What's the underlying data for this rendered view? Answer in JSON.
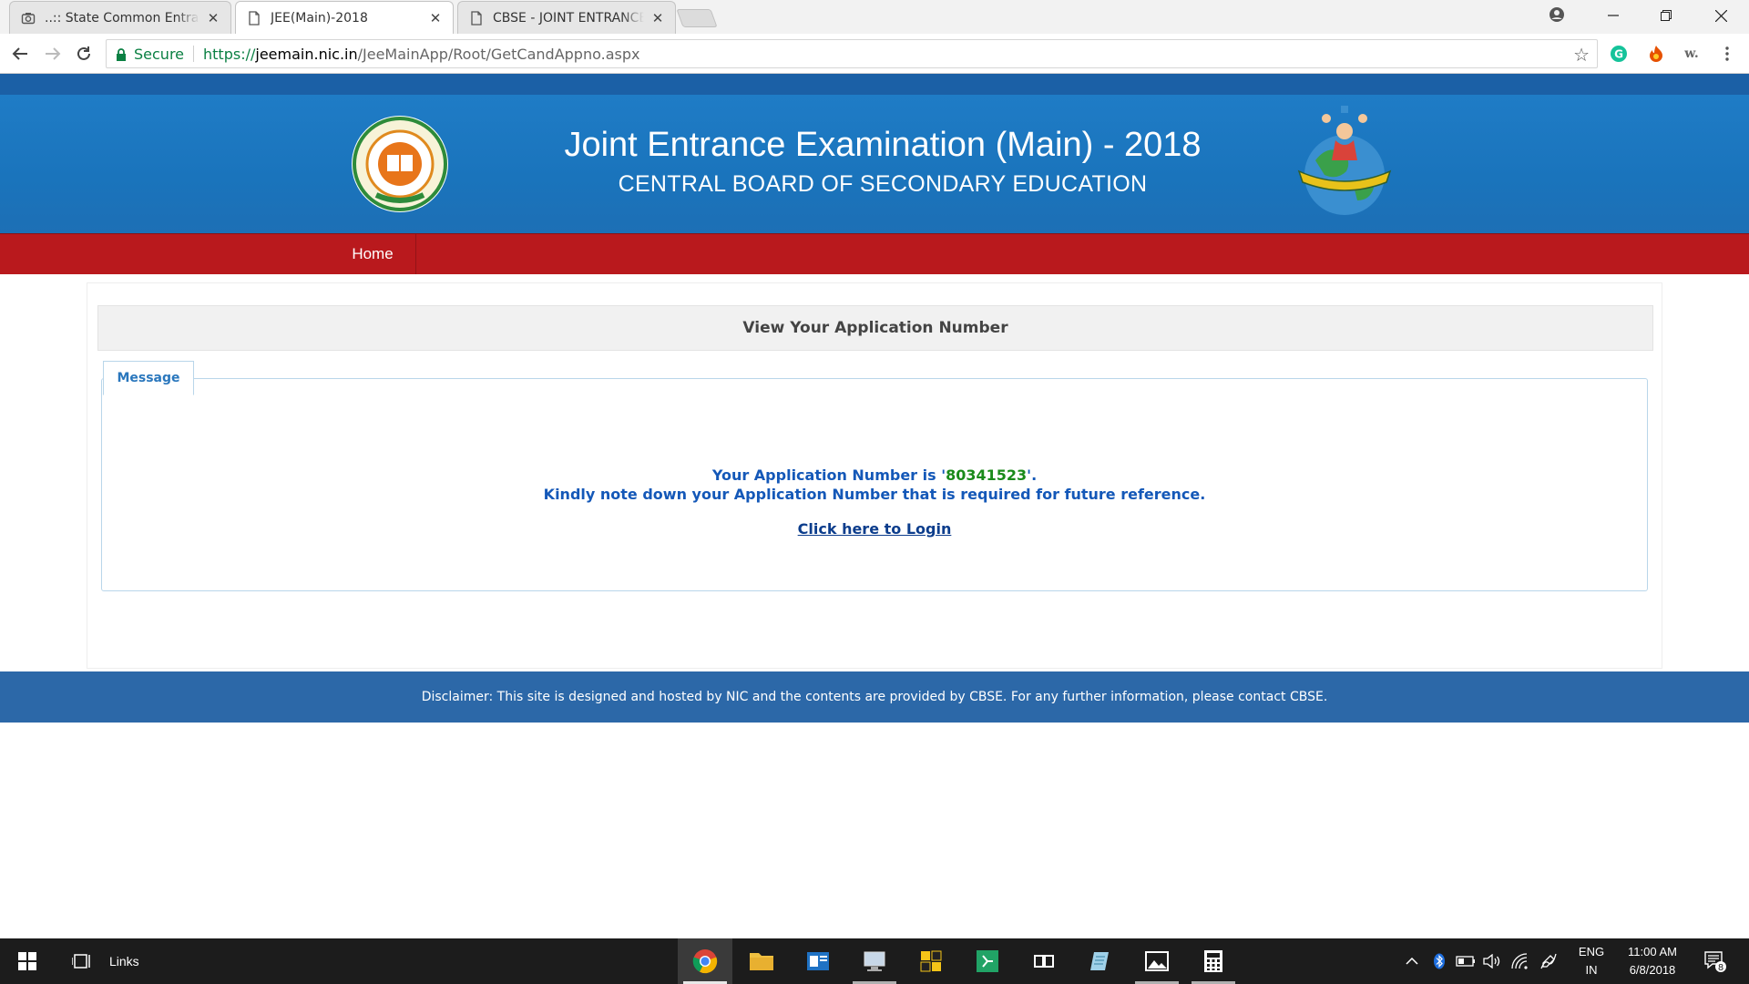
{
  "browser": {
    "tabs": [
      {
        "title": "..:: State Common Entranc",
        "icon": "camera-icon",
        "active": false
      },
      {
        "title": "JEE(Main)-2018",
        "icon": "page-icon",
        "active": true
      },
      {
        "title": "CBSE - JOINT ENTRANCE",
        "icon": "page-icon",
        "active": false
      }
    ],
    "omnibox": {
      "secure_label": "Secure",
      "url_scheme": "https://",
      "url_host": "jeemain.nic.in",
      "url_path": "/JeeMainApp/Root/GetCandAppno.aspx"
    },
    "extensions": {
      "grammarly": "G",
      "word": "w."
    }
  },
  "site": {
    "title": "Joint Entrance Examination (Main) - 2018",
    "subtitle": "CENTRAL BOARD OF SECONDARY EDUCATION",
    "nav": {
      "home": "Home"
    },
    "heading": "View Your Application Number",
    "message_tab": "Message",
    "message": {
      "prefix": "Your Application Number is '",
      "number": "80341523",
      "suffix": "'.",
      "note": "Kindly note down your Application Number that is required for future reference.",
      "login_link": "Click here to Login"
    },
    "footer": "Disclaimer: This site is designed and hosted by NIC and the contents are provided by CBSE. For any further information, please contact CBSE.",
    "colors": {
      "banner": "#1f7cc6",
      "nav": "#b9191d",
      "footer": "#2c68a8",
      "message_text": "#1458b8",
      "app_number": "#1a8a1a"
    }
  },
  "taskbar": {
    "links_label": "Links",
    "language": "ENG",
    "region": "IN",
    "time": "11:00 AM",
    "date": "6/8/2018",
    "notification_count": "8"
  }
}
